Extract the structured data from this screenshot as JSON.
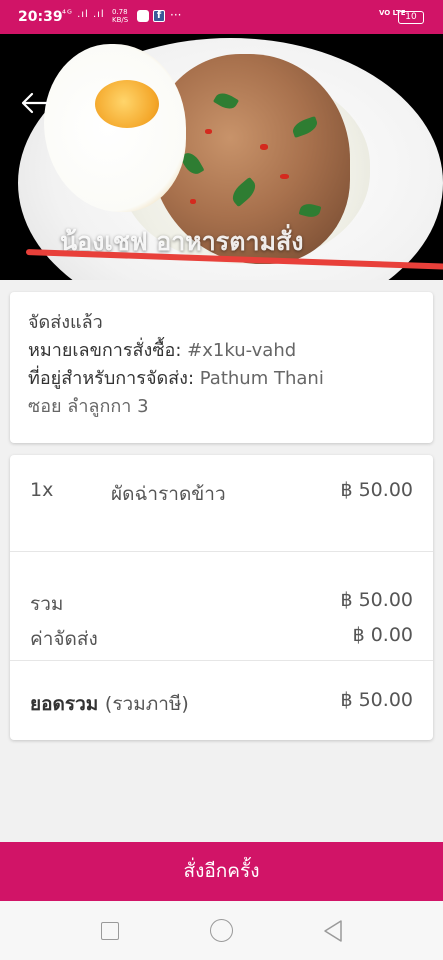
{
  "status_bar": {
    "time": "20:39",
    "signal": "⁴ᴳ .ıl .ıl",
    "net_speed": "0.78",
    "net_unit": "KB/S",
    "more": "···",
    "volte": "VO LTE",
    "battery": "10"
  },
  "header": {
    "back_icon": "arrow-left-icon",
    "image_overlay_text": "น้องเชฟ อาหารตามสั่ง"
  },
  "order_info": {
    "status": "จัดส่งแล้ว",
    "order_number_label": "หมายเลขการสั่งซื้อ:",
    "order_number": "#x1ku-vahd",
    "address_label": "ที่อยู่สำหรับการจัดส่ง:",
    "address_line1": "Pathum Thani",
    "address_line2": "ซอย ลำลูกกา 3"
  },
  "order_items": [
    {
      "qty": "1x",
      "name": "ผัดฉ่าราดข้าว",
      "price": "฿ 50.00"
    }
  ],
  "summary": {
    "subtotal_label": "รวม",
    "subtotal": "฿ 50.00",
    "delivery_label": "ค่าจัดส่ง",
    "delivery": "฿ 0.00",
    "total_label": "ยอดรวม",
    "total_sub": "(รวมภาษี)",
    "total": "฿ 50.00"
  },
  "reorder_button": "สั่งอีกครั้ง",
  "colors": {
    "brand": "#d11467"
  }
}
